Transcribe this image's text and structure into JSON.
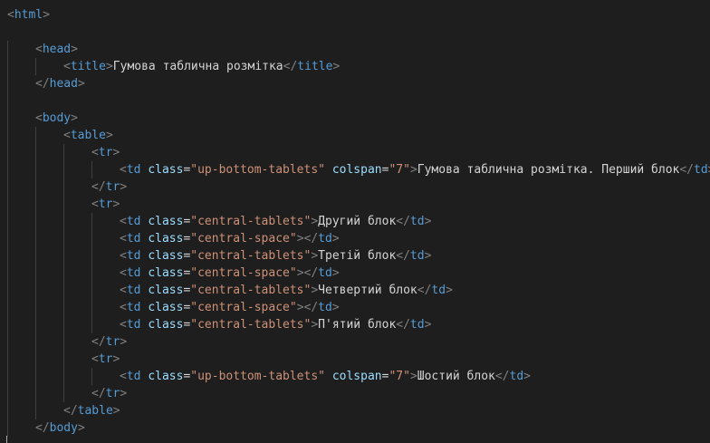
{
  "editor": {
    "theme": {
      "background": "#1e1e1e",
      "bracket": "#808080",
      "tag": "#569cd6",
      "attribute": "#9cdcfe",
      "value": "#ce9178",
      "text": "#d4d4d4"
    },
    "lines": [
      {
        "indent": 0,
        "tokens": [
          [
            "tb",
            "<"
          ],
          [
            "tg",
            "html"
          ],
          [
            "tb",
            ">"
          ]
        ]
      },
      {
        "indent": 0,
        "tokens": []
      },
      {
        "indent": 1,
        "tokens": [
          [
            "tb",
            "<"
          ],
          [
            "tg",
            "head"
          ],
          [
            "tb",
            ">"
          ]
        ]
      },
      {
        "indent": 2,
        "tokens": [
          [
            "tb",
            "<"
          ],
          [
            "tg",
            "title"
          ],
          [
            "tb",
            ">"
          ],
          [
            "tx",
            "Гумова таблична розмітка"
          ],
          [
            "tb",
            "</"
          ],
          [
            "tg",
            "title"
          ],
          [
            "tb",
            ">"
          ]
        ]
      },
      {
        "indent": 1,
        "tokens": [
          [
            "tb",
            "</"
          ],
          [
            "tg",
            "head"
          ],
          [
            "tb",
            ">"
          ]
        ]
      },
      {
        "indent": 0,
        "tokens": []
      },
      {
        "indent": 1,
        "tokens": [
          [
            "tb",
            "<"
          ],
          [
            "tg",
            "body"
          ],
          [
            "tb",
            ">"
          ]
        ]
      },
      {
        "indent": 2,
        "tokens": [
          [
            "tb",
            "<"
          ],
          [
            "tg",
            "table"
          ],
          [
            "tb",
            ">"
          ]
        ]
      },
      {
        "indent": 3,
        "tokens": [
          [
            "tb",
            "<"
          ],
          [
            "tg",
            "tr"
          ],
          [
            "tb",
            ">"
          ]
        ]
      },
      {
        "indent": 4,
        "tokens": [
          [
            "tb",
            "<"
          ],
          [
            "tg",
            "td"
          ],
          [
            "tx",
            " "
          ],
          [
            "at",
            "class"
          ],
          [
            "eq",
            "="
          ],
          [
            "av",
            "\"up-bottom-tablets\""
          ],
          [
            "tx",
            " "
          ],
          [
            "at",
            "colspan"
          ],
          [
            "eq",
            "="
          ],
          [
            "av",
            "\"7\""
          ],
          [
            "tb",
            ">"
          ],
          [
            "tx",
            "Гумова таблична розмітка. Перший блок"
          ],
          [
            "tb",
            "</"
          ],
          [
            "tg",
            "td"
          ],
          [
            "tb",
            ">"
          ]
        ]
      },
      {
        "indent": 3,
        "tokens": [
          [
            "tb",
            "</"
          ],
          [
            "tg",
            "tr"
          ],
          [
            "tb",
            ">"
          ]
        ]
      },
      {
        "indent": 3,
        "tokens": [
          [
            "tb",
            "<"
          ],
          [
            "tg",
            "tr"
          ],
          [
            "tb",
            ">"
          ]
        ]
      },
      {
        "indent": 4,
        "tokens": [
          [
            "tb",
            "<"
          ],
          [
            "tg",
            "td"
          ],
          [
            "tx",
            " "
          ],
          [
            "at",
            "class"
          ],
          [
            "eq",
            "="
          ],
          [
            "av",
            "\"central-tablets\""
          ],
          [
            "tb",
            ">"
          ],
          [
            "tx",
            "Другий блок"
          ],
          [
            "tb",
            "</"
          ],
          [
            "tg",
            "td"
          ],
          [
            "tb",
            ">"
          ]
        ]
      },
      {
        "indent": 4,
        "tokens": [
          [
            "tb",
            "<"
          ],
          [
            "tg",
            "td"
          ],
          [
            "tx",
            " "
          ],
          [
            "at",
            "class"
          ],
          [
            "eq",
            "="
          ],
          [
            "av",
            "\"central-space\""
          ],
          [
            "tb",
            "></"
          ],
          [
            "tg",
            "td"
          ],
          [
            "tb",
            ">"
          ]
        ]
      },
      {
        "indent": 4,
        "tokens": [
          [
            "tb",
            "<"
          ],
          [
            "tg",
            "td"
          ],
          [
            "tx",
            " "
          ],
          [
            "at",
            "class"
          ],
          [
            "eq",
            "="
          ],
          [
            "av",
            "\"central-tablets\""
          ],
          [
            "tb",
            ">"
          ],
          [
            "tx",
            "Третій блок"
          ],
          [
            "tb",
            "</"
          ],
          [
            "tg",
            "td"
          ],
          [
            "tb",
            ">"
          ]
        ]
      },
      {
        "indent": 4,
        "tokens": [
          [
            "tb",
            "<"
          ],
          [
            "tg",
            "td"
          ],
          [
            "tx",
            " "
          ],
          [
            "at",
            "class"
          ],
          [
            "eq",
            "="
          ],
          [
            "av",
            "\"central-space\""
          ],
          [
            "tb",
            "></"
          ],
          [
            "tg",
            "td"
          ],
          [
            "tb",
            ">"
          ]
        ]
      },
      {
        "indent": 4,
        "tokens": [
          [
            "tb",
            "<"
          ],
          [
            "tg",
            "td"
          ],
          [
            "tx",
            " "
          ],
          [
            "at",
            "class"
          ],
          [
            "eq",
            "="
          ],
          [
            "av",
            "\"central-tablets\""
          ],
          [
            "tb",
            ">"
          ],
          [
            "tx",
            "Четвертий блок"
          ],
          [
            "tb",
            "</"
          ],
          [
            "tg",
            "td"
          ],
          [
            "tb",
            ">"
          ]
        ]
      },
      {
        "indent": 4,
        "tokens": [
          [
            "tb",
            "<"
          ],
          [
            "tg",
            "td"
          ],
          [
            "tx",
            " "
          ],
          [
            "at",
            "class"
          ],
          [
            "eq",
            "="
          ],
          [
            "av",
            "\"central-space\""
          ],
          [
            "tb",
            "></"
          ],
          [
            "tg",
            "td"
          ],
          [
            "tb",
            ">"
          ]
        ]
      },
      {
        "indent": 4,
        "tokens": [
          [
            "tb",
            "<"
          ],
          [
            "tg",
            "td"
          ],
          [
            "tx",
            " "
          ],
          [
            "at",
            "class"
          ],
          [
            "eq",
            "="
          ],
          [
            "av",
            "\"central-tablets\""
          ],
          [
            "tb",
            ">"
          ],
          [
            "tx",
            "П'ятий блок"
          ],
          [
            "tb",
            "</"
          ],
          [
            "tg",
            "td"
          ],
          [
            "tb",
            ">"
          ]
        ]
      },
      {
        "indent": 3,
        "tokens": [
          [
            "tb",
            "</"
          ],
          [
            "tg",
            "tr"
          ],
          [
            "tb",
            ">"
          ]
        ]
      },
      {
        "indent": 3,
        "tokens": [
          [
            "tb",
            "<"
          ],
          [
            "tg",
            "tr"
          ],
          [
            "tb",
            ">"
          ]
        ]
      },
      {
        "indent": 4,
        "tokens": [
          [
            "tb",
            "<"
          ],
          [
            "tg",
            "td"
          ],
          [
            "tx",
            " "
          ],
          [
            "at",
            "class"
          ],
          [
            "eq",
            "="
          ],
          [
            "av",
            "\"up-bottom-tablets\""
          ],
          [
            "tx",
            " "
          ],
          [
            "at",
            "colspan"
          ],
          [
            "eq",
            "="
          ],
          [
            "av",
            "\"7\""
          ],
          [
            "tb",
            ">"
          ],
          [
            "tx",
            "Шостий блок"
          ],
          [
            "tb",
            "</"
          ],
          [
            "tg",
            "td"
          ],
          [
            "tb",
            ">"
          ]
        ]
      },
      {
        "indent": 3,
        "tokens": [
          [
            "tb",
            "</"
          ],
          [
            "tg",
            "tr"
          ],
          [
            "tb",
            ">"
          ]
        ]
      },
      {
        "indent": 2,
        "tokens": [
          [
            "tb",
            "</"
          ],
          [
            "tg",
            "table"
          ],
          [
            "tb",
            ">"
          ]
        ]
      },
      {
        "indent": 1,
        "tokens": [
          [
            "tb",
            "</"
          ],
          [
            "tg",
            "body"
          ],
          [
            "tb",
            ">"
          ]
        ]
      }
    ]
  }
}
